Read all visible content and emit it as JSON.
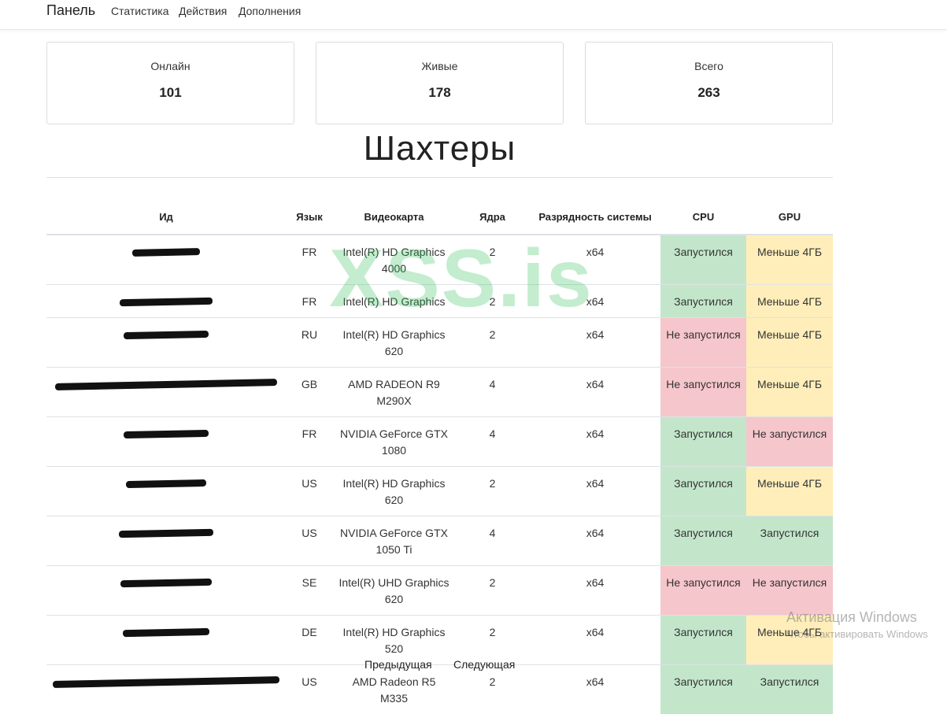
{
  "navbar": {
    "brand": "Панель",
    "links": [
      "Статистика",
      "Действия",
      "Дополнения"
    ]
  },
  "stats": [
    {
      "label": "Онлайн",
      "value": "101"
    },
    {
      "label": "Живые",
      "value": "178"
    },
    {
      "label": "Всего",
      "value": "263"
    }
  ],
  "page_title": "Шахтеры",
  "table": {
    "headers": [
      "Ид",
      "Язык",
      "Видеокарта",
      "Ядра",
      "Разрядность системы",
      "CPU",
      "GPU"
    ],
    "rows": [
      {
        "id": "",
        "lang": "FR",
        "gpu_name": "Intel(R) HD Graphics 4000",
        "cores": "2",
        "arch": "x64",
        "cpu": "Запустился",
        "cpu_status": "ok",
        "gpu": "Меньше 4ГБ",
        "gpu_status": "warn"
      },
      {
        "id": "",
        "lang": "FR",
        "gpu_name": "Intel(R) HD Graphics",
        "cores": "2",
        "arch": "x64",
        "cpu": "Запустился",
        "cpu_status": "ok",
        "gpu": "Меньше 4ГБ",
        "gpu_status": "warn"
      },
      {
        "id": "",
        "lang": "RU",
        "gpu_name": "Intel(R) HD Graphics 620",
        "cores": "2",
        "arch": "x64",
        "cpu": "Не запустился",
        "cpu_status": "fail",
        "gpu": "Меньше 4ГБ",
        "gpu_status": "warn"
      },
      {
        "id": "",
        "lang": "GB",
        "gpu_name": "AMD RADEON R9 M290X",
        "cores": "4",
        "arch": "x64",
        "cpu": "Не запустился",
        "cpu_status": "fail",
        "gpu": "Меньше 4ГБ",
        "gpu_status": "warn"
      },
      {
        "id": "",
        "lang": "FR",
        "gpu_name": "NVIDIA GeForce GTX 1080",
        "cores": "4",
        "arch": "x64",
        "cpu": "Запустился",
        "cpu_status": "ok",
        "gpu": "Не запустился",
        "gpu_status": "fail"
      },
      {
        "id": "",
        "lang": "US",
        "gpu_name": "Intel(R) HD Graphics 620",
        "cores": "2",
        "arch": "x64",
        "cpu": "Запустился",
        "cpu_status": "ok",
        "gpu": "Меньше 4ГБ",
        "gpu_status": "warn"
      },
      {
        "id": "",
        "lang": "US",
        "gpu_name": "NVIDIA GeForce GTX 1050 Ti",
        "cores": "4",
        "arch": "x64",
        "cpu": "Запустился",
        "cpu_status": "ok",
        "gpu": "Запустился",
        "gpu_status": "ok"
      },
      {
        "id": "",
        "lang": "SE",
        "gpu_name": "Intel(R) UHD Graphics 620",
        "cores": "2",
        "arch": "x64",
        "cpu": "Не запустился",
        "cpu_status": "fail",
        "gpu": "Не запустился",
        "gpu_status": "fail"
      },
      {
        "id": "",
        "lang": "DE",
        "gpu_name": "Intel(R) HD Graphics 520",
        "cores": "2",
        "arch": "x64",
        "cpu": "Запустился",
        "cpu_status": "ok",
        "gpu": "Меньше 4ГБ",
        "gpu_status": "warn"
      },
      {
        "id": "",
        "lang": "US",
        "gpu_name": "AMD Radeon R5 M335",
        "cores": "2",
        "arch": "x64",
        "cpu": "Запустился",
        "cpu_status": "ok",
        "gpu": "Запустился",
        "gpu_status": "ok"
      }
    ]
  },
  "pagination": {
    "prev": "Предыдущая",
    "next": "Следующая"
  },
  "watermark": "XSS.is",
  "windows_activation": {
    "title": "Активация Windows",
    "subtitle": "Чтобы активировать Windows"
  },
  "colors": {
    "ok": "#c3e6cb",
    "fail": "#f5c6cb",
    "warn": "#ffeeba"
  }
}
